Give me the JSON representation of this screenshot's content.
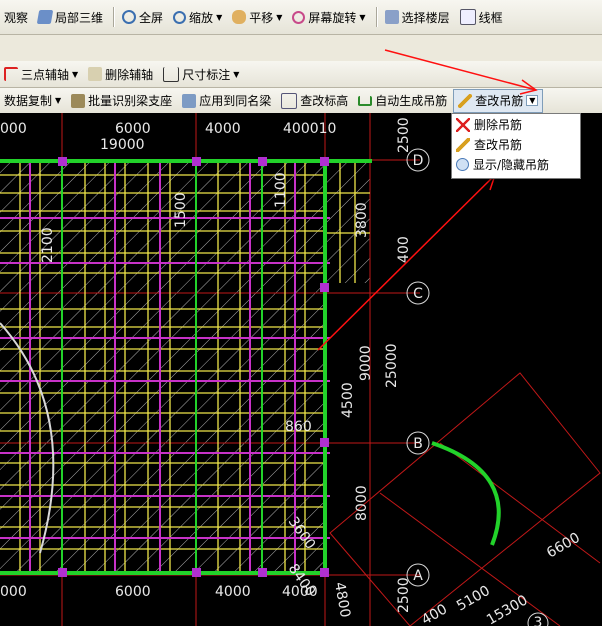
{
  "toolbar_row1": {
    "view_label": "观察",
    "local_3d_label": "局部三维",
    "fullscreen_label": "全屏",
    "zoom_label": "缩放",
    "pan_label": "平移",
    "rotate_label": "屏幕旋转",
    "select_floor_label": "选择楼层",
    "wireframe_label": "线框"
  },
  "toolbar_row2": {
    "three_point_axis_label": "三点辅轴",
    "delete_axis_label": "删除辅轴",
    "dimension_label": "尺寸标注"
  },
  "toolbar_row3": {
    "data_copy_label": "数据复制",
    "batch_identify_label": "批量识别梁支座",
    "apply_same_beam_label": "应用到同名梁",
    "check_elevation_label": "查改标高",
    "auto_hanger_label": "自动生成吊筋",
    "edit_hanger_label": "查改吊筋"
  },
  "dropdown_menu": {
    "items": [
      {
        "label": "删除吊筋",
        "icon": "delete-hanger-icon"
      },
      {
        "label": "查改吊筋",
        "icon": "edit-hanger-icon"
      },
      {
        "label": "显示/隐藏吊筋",
        "icon": "show-hide-hanger-icon"
      }
    ]
  },
  "drawing": {
    "axis_labels": {
      "d": "D",
      "c": "C",
      "b": "B",
      "a": "A",
      "bottom_3": "3"
    },
    "dimensions": {
      "top_left": "000",
      "top_mid": "6000",
      "top_mid2": "4000",
      "top_right": "400010",
      "top_sub": "19000",
      "right_2500_top": "2500",
      "right_400": "400",
      "right_25000": "25000",
      "right_9000": "9000",
      "right_4500": "4500",
      "right_8000": "8000",
      "right_2500_bottom": "2500",
      "vert_3800": "3800",
      "vert_2100": "2100",
      "vert_1500": "1500",
      "vert_1100": "1100",
      "dim_860": "860",
      "dim_3600": "3600",
      "dim_8400": "8400",
      "dim_4800": "4800",
      "dim_6600": "6600",
      "dim_5100": "5100",
      "dim_15300": "15300",
      "dim_400": "400",
      "bottom_000": "000",
      "bottom_6000": "6000",
      "bottom_4000a": "4000",
      "bottom_4000b": "4000"
    }
  },
  "colors": {
    "beam_yellow": "#f0e64a",
    "beam_magenta": "#c832c8",
    "wall_green": "#22d22a",
    "axis_red": "#d42020",
    "annotation_red": "#ff1010",
    "dim_white": "#e8e8e8"
  }
}
